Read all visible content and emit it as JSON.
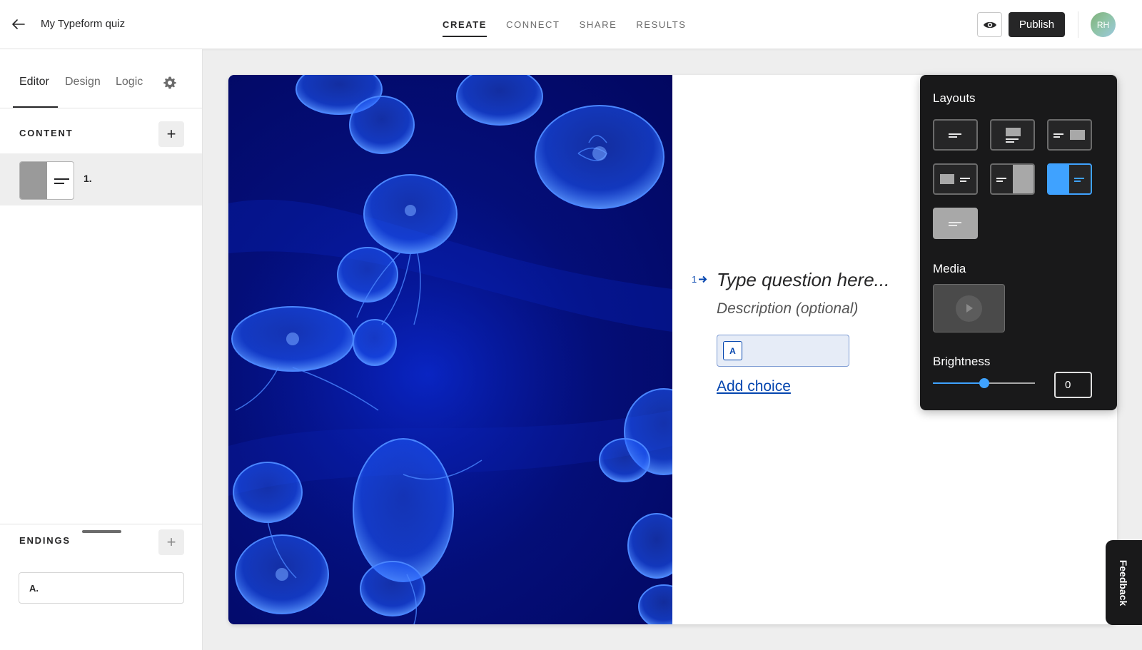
{
  "header": {
    "form_title": "My Typeform quiz",
    "tabs": [
      {
        "label": "CREATE",
        "active": true
      },
      {
        "label": "CONNECT",
        "active": false
      },
      {
        "label": "SHARE",
        "active": false
      },
      {
        "label": "RESULTS",
        "active": false
      }
    ],
    "publish_label": "Publish",
    "avatar_initials": "RH",
    "icons": {
      "back": "arrow-left-icon",
      "preview": "eye-icon"
    }
  },
  "sidebar": {
    "tabs": [
      {
        "label": "Editor",
        "active": true
      },
      {
        "label": "Design",
        "active": false
      },
      {
        "label": "Logic",
        "active": false
      }
    ],
    "settings_icon": "gear-icon",
    "content_label": "CONTENT",
    "add_label": "+",
    "questions": [
      {
        "number": "1."
      }
    ],
    "endings_label": "ENDINGS",
    "endings": [
      {
        "label": "A."
      }
    ]
  },
  "canvas": {
    "question_number": "1",
    "question_placeholder": "Type question here...",
    "description_placeholder": "Description (optional)",
    "choices": [
      {
        "key": "A",
        "value": ""
      }
    ],
    "add_choice_label": "Add choice",
    "image_subject": "jellyfish"
  },
  "layout_panel": {
    "layouts_heading": "Layouts",
    "selected_layout_index": 5,
    "media_heading": "Media",
    "brightness_heading": "Brightness",
    "brightness_value": "0",
    "brightness_position": 0.5
  },
  "feedback_label": "Feedback",
  "colors": {
    "accent_blue": "#0445af",
    "selection_blue": "#3fa2ff",
    "dark_panel": "#19191a",
    "canvas_background": "#eeeeee"
  }
}
